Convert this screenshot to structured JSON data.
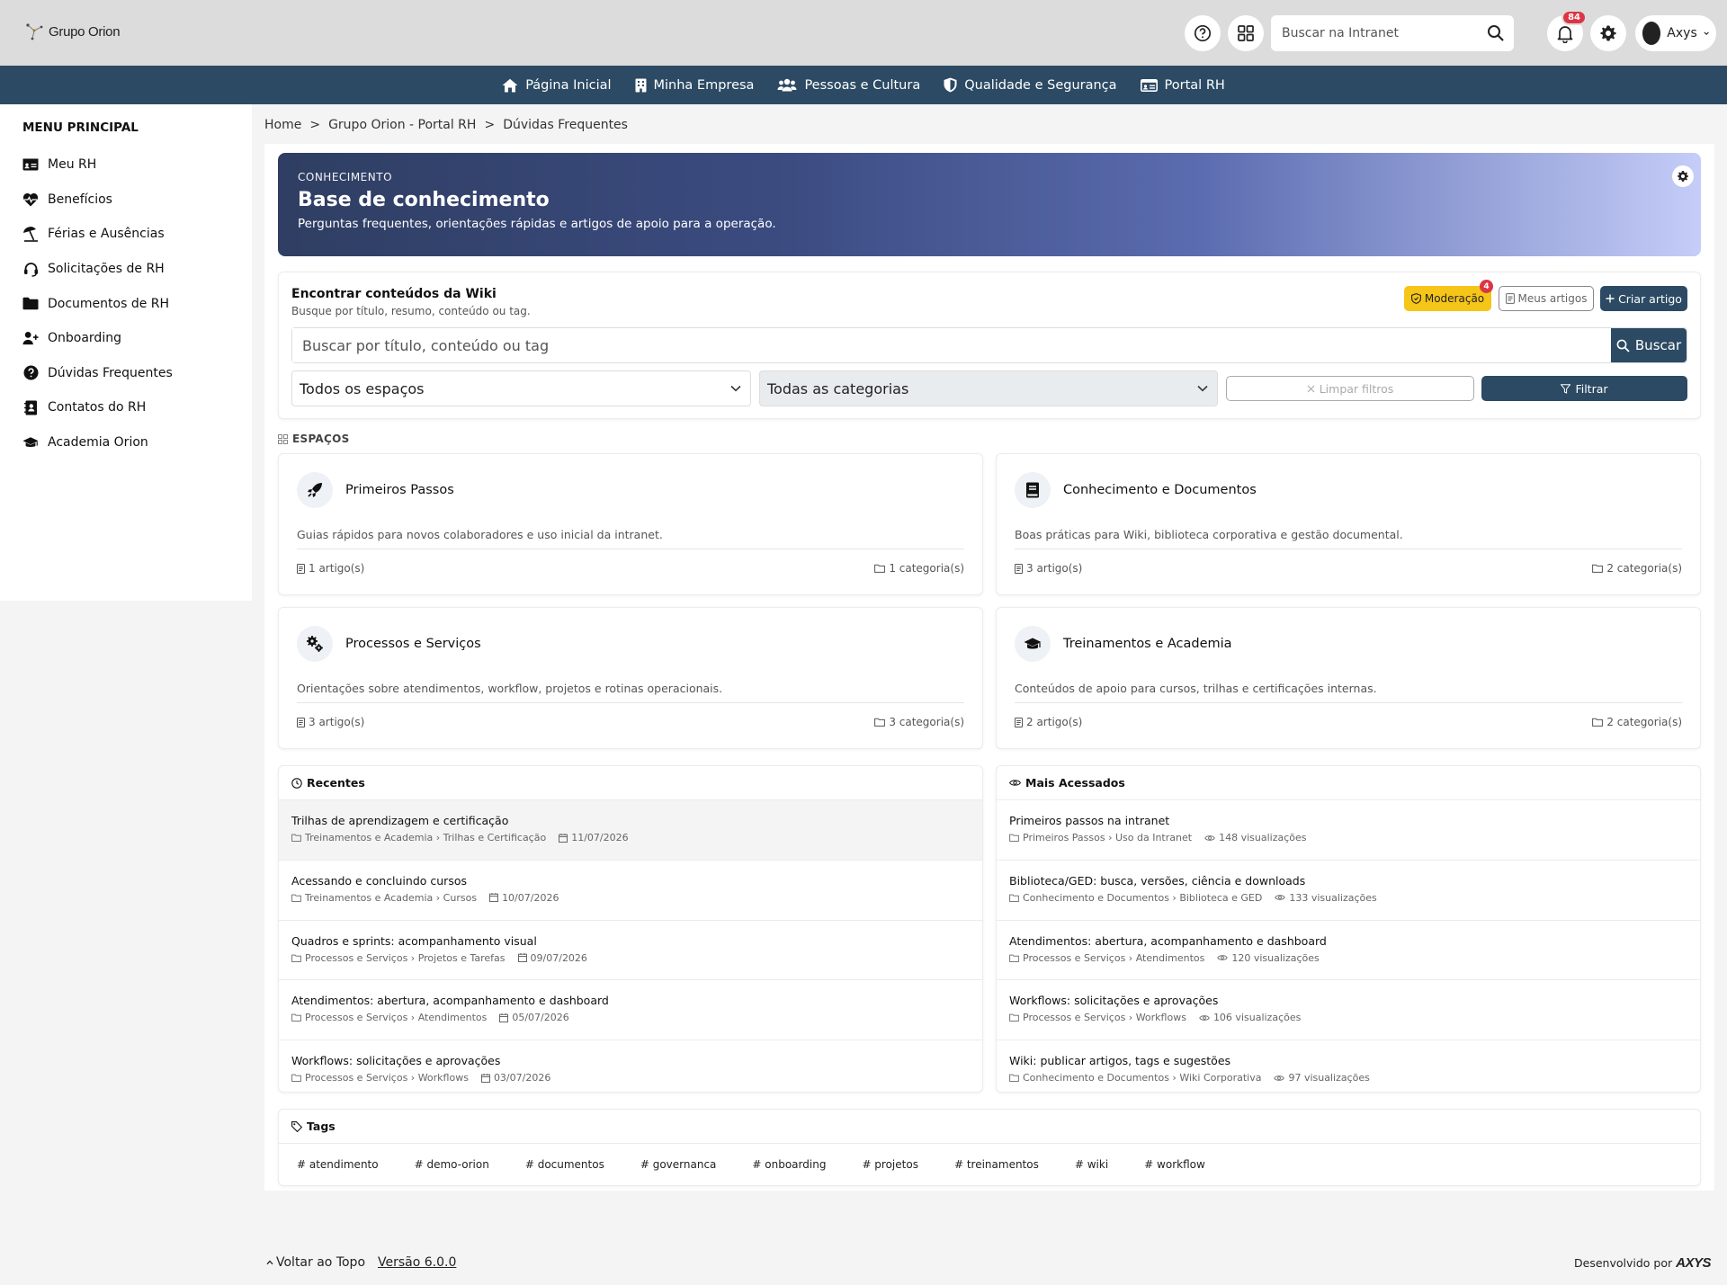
{
  "header": {
    "logo_text": "Grupo Orion",
    "search_placeholder": "Buscar na Intranet",
    "notifications_count": "84",
    "user_name": "Axys"
  },
  "nav": [
    {
      "label": "Página Inicial",
      "icon": "home-icon"
    },
    {
      "label": "Minha Empresa",
      "icon": "building-icon"
    },
    {
      "label": "Pessoas e Cultura",
      "icon": "users-icon"
    },
    {
      "label": "Qualidade e Segurança",
      "icon": "shield-icon"
    },
    {
      "label": "Portal RH",
      "icon": "id-card-icon"
    }
  ],
  "sidebar": {
    "title": "MENU PRINCIPAL",
    "items": [
      {
        "label": "Meu RH",
        "icon": "id-card-icon"
      },
      {
        "label": "Benefícios",
        "icon": "heart-pulse-icon"
      },
      {
        "label": "Férias e Ausências",
        "icon": "umbrella-beach-icon"
      },
      {
        "label": "Solicitações de RH",
        "icon": "headset-icon"
      },
      {
        "label": "Documentos de RH",
        "icon": "folder-icon"
      },
      {
        "label": "Onboarding",
        "icon": "user-plus-icon"
      },
      {
        "label": "Dúvidas Frequentes",
        "icon": "question-circle-icon"
      },
      {
        "label": "Contatos do RH",
        "icon": "contact-book-icon"
      },
      {
        "label": "Academia Orion",
        "icon": "graduation-cap-icon"
      }
    ]
  },
  "breadcrumb": [
    "Home",
    ">",
    "Grupo Orion - Portal RH",
    ">",
    "Dúvidas Frequentes"
  ],
  "hero": {
    "kicker": "CONHECIMENTO",
    "title": "Base de conhecimento",
    "subtitle": "Perguntas frequentes, orientações rápidas e artigos de apoio para a operação."
  },
  "finder": {
    "title": "Encontrar conteúdos da Wiki",
    "subtitle": "Busque por título, resumo, conteúdo ou tag.",
    "moderation_label": "Moderação",
    "moderation_count": "4",
    "my_articles_label": "Meus artigos",
    "create_label": "Criar artigo",
    "search_placeholder": "Buscar por título, conteúdo ou tag",
    "search_button": "Buscar",
    "spaces_select": "Todos os espaços",
    "categories_select": "Todas as categorias",
    "clear_label": "Limpar filtros",
    "filter_label": "Filtrar"
  },
  "spaces_label": "ESPAÇOS",
  "spaces": [
    {
      "title": "Primeiros Passos",
      "icon": "rocket-icon",
      "desc": "Guias rápidos para novos colaboradores e uso inicial da intranet.",
      "articles": "1 artigo(s)",
      "categories": "1 categoria(s)"
    },
    {
      "title": "Conhecimento e Documentos",
      "icon": "book-icon",
      "desc": "Boas práticas para Wiki, biblioteca corporativa e gestão documental.",
      "articles": "3 artigo(s)",
      "categories": "2 categoria(s)"
    },
    {
      "title": "Processos e Serviços",
      "icon": "gears-icon",
      "desc": "Orientações sobre atendimentos, workflow, projetos e rotinas operacionais.",
      "articles": "3 artigo(s)",
      "categories": "3 categoria(s)"
    },
    {
      "title": "Treinamentos e Academia",
      "icon": "graduation-cap-icon",
      "desc": "Conteúdos de apoio para cursos, trilhas e certificações internas.",
      "articles": "2 artigo(s)",
      "categories": "2 categoria(s)"
    }
  ],
  "recent": {
    "title": "Recentes",
    "items": [
      {
        "title": "Trilhas de aprendizagem e certificação",
        "path": "Treinamentos e Academia › Trilhas e Certificação",
        "date": "11/07/2026"
      },
      {
        "title": "Acessando e concluindo cursos",
        "path": "Treinamentos e Academia › Cursos",
        "date": "10/07/2026"
      },
      {
        "title": "Quadros e sprints: acompanhamento visual",
        "path": "Processos e Serviços › Projetos e Tarefas",
        "date": "09/07/2026"
      },
      {
        "title": "Atendimentos: abertura, acompanhamento e dashboard",
        "path": "Processos e Serviços › Atendimentos",
        "date": "05/07/2026"
      },
      {
        "title": "Workflows: solicitações e aprovações",
        "path": "Processos e Serviços › Workflows",
        "date": "03/07/2026"
      }
    ]
  },
  "popular": {
    "title": "Mais Acessados",
    "items": [
      {
        "title": "Primeiros passos na intranet",
        "path": "Primeiros Passos › Uso da Intranet",
        "views": "148 visualizações"
      },
      {
        "title": "Biblioteca/GED: busca, versões, ciência e downloads",
        "path": "Conhecimento e Documentos › Biblioteca e GED",
        "views": "133 visualizações"
      },
      {
        "title": "Atendimentos: abertura, acompanhamento e dashboard",
        "path": "Processos e Serviços › Atendimentos",
        "views": "120 visualizações"
      },
      {
        "title": "Workflows: solicitações e aprovações",
        "path": "Processos e Serviços › Workflows",
        "views": "106 visualizações"
      },
      {
        "title": "Wiki: publicar artigos, tags e sugestões",
        "path": "Conhecimento e Documentos › Wiki Corporativa",
        "views": "97 visualizações"
      }
    ]
  },
  "tags": {
    "title": "Tags",
    "items": [
      "# atendimento",
      "# demo-orion",
      "# documentos",
      "# governanca",
      "# onboarding",
      "# projetos",
      "# treinamentos",
      "# wiki",
      "# workflow"
    ]
  },
  "footer": {
    "back_to_top": "Voltar ao Topo",
    "version": "Versão 6.0.0",
    "developed_by": "Desenvolvido por",
    "brand": "AXYS"
  },
  "colors": {
    "primary": "#2c4a63",
    "warning": "#f5c518",
    "badge": "#dc3545"
  }
}
